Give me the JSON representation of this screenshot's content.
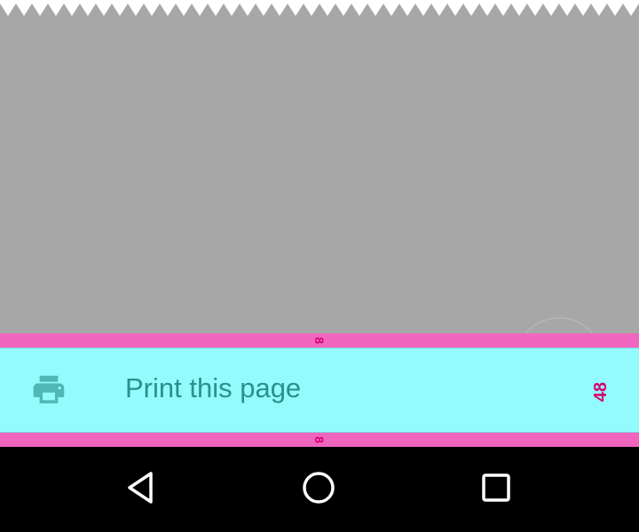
{
  "list_item": {
    "icon": "print-icon",
    "label": "Print this page",
    "height_annotation": "48"
  },
  "spacing": {
    "top_annotation": "8",
    "bottom_annotation": "8"
  },
  "nav": {
    "back_icon": "back-triangle-icon",
    "home_icon": "home-circle-icon",
    "recents_icon": "recents-square-icon"
  },
  "colors": {
    "content_bg": "#a7a7a7",
    "row_bg": "#93fbfb",
    "row_text": "#26928f",
    "annotation_strip": "#f066bf",
    "annotation_text": "#d6006f",
    "nav_bg": "#000000"
  }
}
